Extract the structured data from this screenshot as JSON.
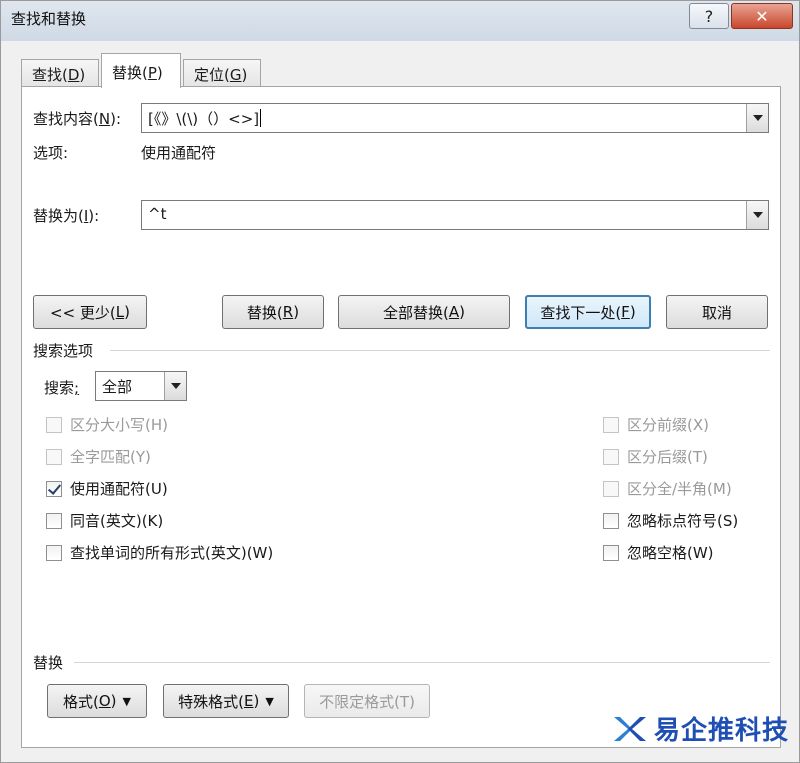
{
  "window": {
    "title": "查找和替换",
    "help_label": "?",
    "close_label": "✕"
  },
  "tabs": [
    {
      "label_pre": "查找(",
      "hotkey": "D",
      "label_post": ")",
      "active": false
    },
    {
      "label_pre": "替换(",
      "hotkey": "P",
      "label_post": ")",
      "active": true
    },
    {
      "label_pre": "定位(",
      "hotkey": "G",
      "label_post": ")",
      "active": false
    }
  ],
  "find": {
    "label_pre": "查找内容(",
    "hotkey": "N",
    "label_post": "):",
    "value": "[《》\\(\\)（）<>]",
    "options_label": "选项:",
    "options_value": "使用通配符"
  },
  "replace": {
    "label_pre": "替换为(",
    "hotkey": "I",
    "label_post": "):",
    "value": "^t"
  },
  "buttons": {
    "less": {
      "pre": "<< 更少(",
      "hotkey": "L",
      "post": ")"
    },
    "replace": {
      "pre": "替换(",
      "hotkey": "R",
      "post": ")"
    },
    "replace_all": {
      "pre": "全部替换(",
      "hotkey": "A",
      "post": ")"
    },
    "find_next": {
      "pre": "查找下一处(",
      "hotkey": "F",
      "post": ")"
    },
    "cancel": "取消"
  },
  "search_options": {
    "title": "搜索选项",
    "search_label_pre": "搜索",
    "search_hotkey": ";",
    "search_value": "全部",
    "left": [
      {
        "text": "区分大小写(H)",
        "checked": false,
        "disabled": true
      },
      {
        "text": "全字匹配(Y)",
        "checked": false,
        "disabled": true
      },
      {
        "text": "使用通配符(U)",
        "checked": true,
        "disabled": false
      },
      {
        "text": "同音(英文)(K)",
        "checked": false,
        "disabled": false
      },
      {
        "text": "查找单词的所有形式(英文)(W)",
        "checked": false,
        "disabled": false
      }
    ],
    "right": [
      {
        "text": "区分前缀(X)",
        "checked": false,
        "disabled": true
      },
      {
        "text": "区分后缀(T)",
        "checked": false,
        "disabled": true
      },
      {
        "text": "区分全/半角(M)",
        "checked": false,
        "disabled": true
      },
      {
        "text": "忽略标点符号(S)",
        "checked": false,
        "disabled": false
      },
      {
        "text": "忽略空格(W)",
        "checked": false,
        "disabled": false
      }
    ]
  },
  "replace_section": {
    "title": "替换",
    "format": {
      "pre": "格式(",
      "hotkey": "O",
      "post": ")"
    },
    "special": {
      "pre": "特殊格式(",
      "hotkey": "E",
      "post": ")"
    },
    "no_format": "不限定格式(T)"
  },
  "watermark": "易企推科技",
  "colors": {
    "accent": "#3c7fb1",
    "close": "#c9462c",
    "watermark": "#1f4fb4"
  }
}
